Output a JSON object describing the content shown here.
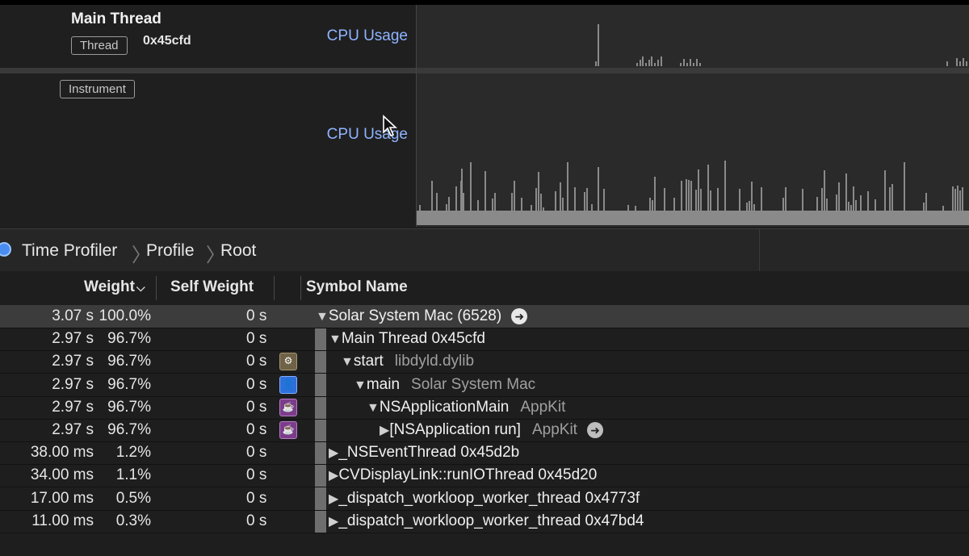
{
  "tracks": {
    "main_thread": {
      "title": "Main Thread",
      "tag": "Thread",
      "id": "0x45cfd",
      "metric": "CPU Usage"
    },
    "instrument": {
      "tag": "Instrument",
      "metric": "CPU Usage"
    }
  },
  "breadcrumb": [
    "Time Profiler",
    "Profile",
    "Root"
  ],
  "columns": {
    "weight": "Weight",
    "self_weight": "Self Weight",
    "symbol": "Symbol Name"
  },
  "rows": [
    {
      "weight": "3.07 s",
      "pct": "100.0%",
      "self": "0 s",
      "icon": "",
      "expanded": true,
      "symbol": "Solar System Mac (6528)",
      "lib": "",
      "go": true
    },
    {
      "weight": "2.97 s",
      "pct": "96.7%",
      "self": "0 s",
      "icon": "",
      "expanded": true,
      "symbol": "Main Thread  0x45cfd",
      "lib": "",
      "go": false
    },
    {
      "weight": "2.97 s",
      "pct": "96.7%",
      "self": "0 s",
      "icon": "gear-icon",
      "expanded": true,
      "symbol": "start",
      "lib": "libdyld.dylib",
      "go": false
    },
    {
      "weight": "2.97 s",
      "pct": "96.7%",
      "self": "0 s",
      "icon": "user-icon",
      "expanded": true,
      "symbol": "main",
      "lib": "Solar System Mac",
      "go": false
    },
    {
      "weight": "2.97 s",
      "pct": "96.7%",
      "self": "0 s",
      "icon": "coffee-cup-icon",
      "expanded": true,
      "symbol": "NSApplicationMain",
      "lib": "AppKit",
      "go": false
    },
    {
      "weight": "2.97 s",
      "pct": "96.7%",
      "self": "0 s",
      "icon": "coffee-cup-icon",
      "expanded": false,
      "symbol": "[NSApplication run]",
      "lib": "AppKit",
      "go": true
    },
    {
      "weight": "38.00 ms",
      "pct": "1.2%",
      "self": "0 s",
      "icon": "",
      "expanded": false,
      "symbol": "_NSEventThread  0x45d2b",
      "lib": "",
      "go": false
    },
    {
      "weight": "34.00 ms",
      "pct": "1.1%",
      "self": "0 s",
      "icon": "",
      "expanded": false,
      "symbol": "CVDisplayLink::runIOThread  0x45d20",
      "lib": "",
      "go": false
    },
    {
      "weight": "17.00 ms",
      "pct": "0.5%",
      "self": "0 s",
      "icon": "",
      "expanded": false,
      "symbol": "_dispatch_workloop_worker_thread  0x4773f",
      "lib": "",
      "go": false
    },
    {
      "weight": "11.00 ms",
      "pct": "0.3%",
      "self": "0 s",
      "icon": "",
      "expanded": false,
      "symbol": "_dispatch_workloop_worker_thread  0x47bd4",
      "lib": "",
      "go": false
    }
  ],
  "colors": {
    "accent_blue": "#8fb4ff",
    "graph_bar": "#8a8a8a",
    "selected_row": "#3c3c3c"
  }
}
